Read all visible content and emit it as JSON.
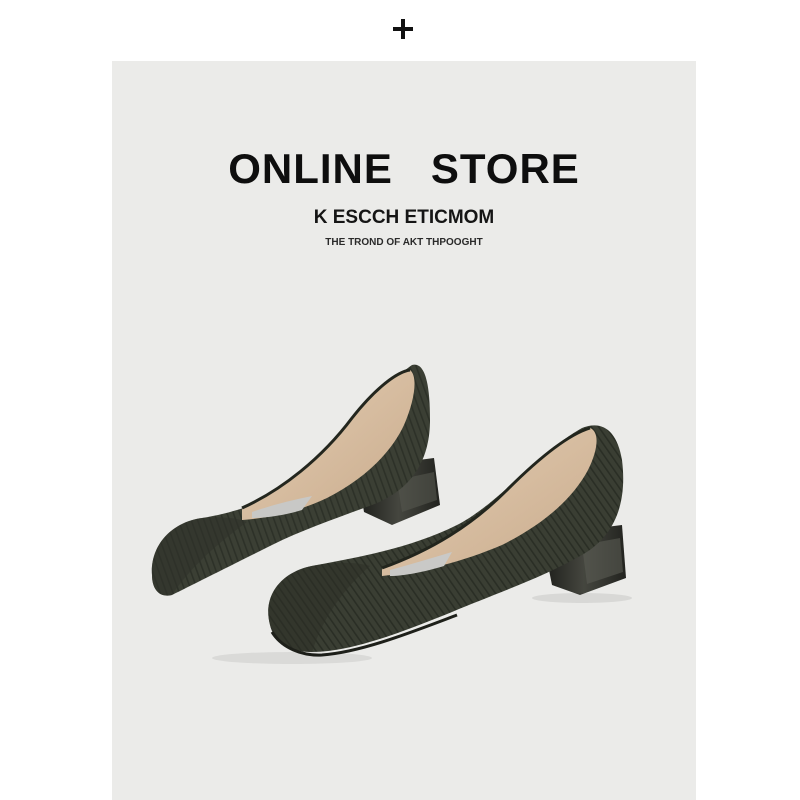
{
  "header": {
    "icon": "plus-icon"
  },
  "banner": {
    "headline": "ONLINE   STORE",
    "subhead": "K ESCCH ETICMOM",
    "tagline": "THE TROND OF AKT THPOOGHT"
  },
  "product_image": {
    "subject": "shoe-pair",
    "colors": {
      "background": "#ebebe9",
      "knit": "#3b3f34",
      "knit_dark": "#25281f",
      "lining": "#d9bfa3",
      "heel": "#2b2c27"
    }
  }
}
